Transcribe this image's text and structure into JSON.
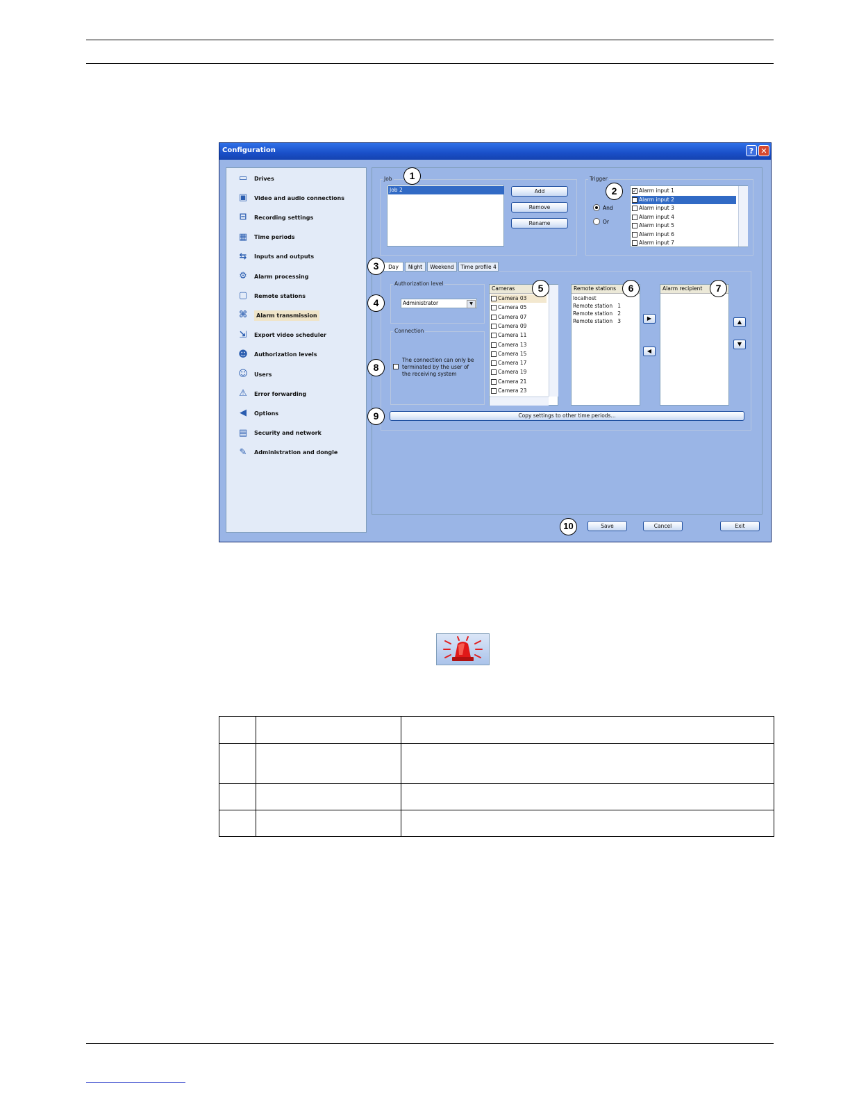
{
  "window": {
    "title": "Configuration"
  },
  "sidebar": {
    "items": [
      {
        "label": "Drives",
        "icon": "drives-icon"
      },
      {
        "label": "Video and audio connections",
        "icon": "video-audio-icon"
      },
      {
        "label": "Recording settings",
        "icon": "recording-icon"
      },
      {
        "label": "Time periods",
        "icon": "calendar-icon"
      },
      {
        "label": "Inputs and outputs",
        "icon": "io-icon"
      },
      {
        "label": "Alarm processing",
        "icon": "gears-icon"
      },
      {
        "label": "Remote stations",
        "icon": "monitor-icon"
      },
      {
        "label": "Alarm transmission",
        "icon": "network-icon"
      },
      {
        "label": "Export video scheduler",
        "icon": "export-icon"
      },
      {
        "label": "Authorization levels",
        "icon": "users-group-icon"
      },
      {
        "label": "Users",
        "icon": "users-icon"
      },
      {
        "label": "Error forwarding",
        "icon": "warning-icon"
      },
      {
        "label": "Options",
        "icon": "speaker-icon"
      },
      {
        "label": "Security and network",
        "icon": "lock-icon"
      },
      {
        "label": "Administration and dongle",
        "icon": "wrench-icon"
      }
    ]
  },
  "job": {
    "label": "Job",
    "items": [
      "Job 2"
    ],
    "add": "Add",
    "remove": "Remove",
    "rename": "Rename"
  },
  "trigger": {
    "label": "Trigger",
    "and": "And",
    "or": "Or",
    "inputs": [
      {
        "label": "Alarm input 1",
        "checked": true
      },
      {
        "label": "Alarm input 2",
        "checked": true
      },
      {
        "label": "Alarm input 3",
        "checked": false
      },
      {
        "label": "Alarm input 4",
        "checked": false
      },
      {
        "label": "Alarm input 5",
        "checked": false
      },
      {
        "label": "Alarm input 6",
        "checked": false
      },
      {
        "label": "Alarm input 7",
        "checked": false
      }
    ]
  },
  "tabs": [
    "Day",
    "Night",
    "Weekend",
    "Time profile 4"
  ],
  "auth": {
    "label": "Authorization level",
    "value": "Administrator"
  },
  "connection": {
    "label": "Connection",
    "line1": "The connection can only be",
    "line2": "terminated by the user of",
    "line3": "the receiving system"
  },
  "cameras": {
    "header": "Cameras",
    "items": [
      "Camera 03",
      "Camera 05",
      "Camera 07",
      "Camera 09",
      "Camera 11",
      "Camera 13",
      "Camera 15",
      "Camera 17",
      "Camera 19",
      "Camera 21",
      "Camera 23"
    ]
  },
  "remote": {
    "header": "Remote stations",
    "items": [
      "localhost",
      "Remote station   1",
      "Remote station   2",
      "Remote station   3"
    ]
  },
  "recipient": {
    "header": "Alarm recipient"
  },
  "copy_button": "Copy settings to other time periods...",
  "footer": {
    "save": "Save",
    "cancel": "Cancel",
    "exit": "Exit"
  },
  "callouts": [
    "1",
    "2",
    "3",
    "4",
    "5",
    "6",
    "7",
    "8",
    "9",
    "10"
  ],
  "colors": {
    "titlebar": "#1a4fc8",
    "window_bg": "#9ab5e6",
    "selection": "#316ac5"
  }
}
